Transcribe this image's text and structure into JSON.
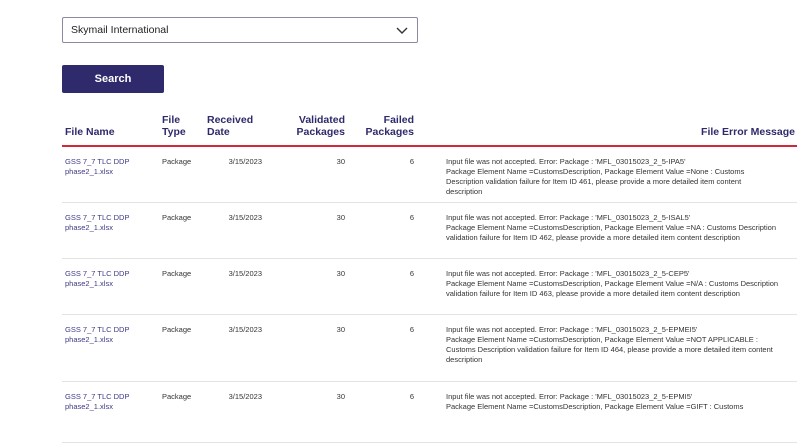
{
  "filter": {
    "selected": "Skymail International"
  },
  "search_button": "Search",
  "table": {
    "headers": {
      "file_name": "File Name",
      "file_type": [
        "File",
        "Type"
      ],
      "received_date": [
        "Received",
        "Date"
      ],
      "validated": [
        "Validated",
        "Packages"
      ],
      "failed": [
        "Failed",
        "Packages"
      ],
      "error": "File Error Message"
    },
    "rows": [
      {
        "file_name": [
          "GSS 7_7 TLC DDP",
          "phase2_1.xlsx"
        ],
        "file_type": "Package",
        "received_date": "3/15/2023",
        "validated": "30",
        "failed": "6",
        "error": [
          "Input file was not accepted. Error: Package : 'MFL_03015023_2_5-IPA5'",
          "Package Element Name =CustomsDescription, Package Element Value =None : Customs",
          "Description validation failure for Item ID 461, please provide a more detailed item content",
          "description"
        ]
      },
      {
        "file_name": [
          "GSS 7_7 TLC DDP",
          "phase2_1.xlsx"
        ],
        "file_type": "Package",
        "received_date": "3/15/2023",
        "validated": "30",
        "failed": "6",
        "error": [
          "Input file was not accepted. Error: Package : 'MFL_03015023_2_5-ISAL5'",
          "Package Element Name =CustomsDescription, Package Element Value =NA : Customs Description",
          "validation failure for Item ID 462, please provide a more detailed item content description"
        ]
      },
      {
        "file_name": [
          "GSS 7_7 TLC DDP",
          "phase2_1.xlsx"
        ],
        "file_type": "Package",
        "received_date": "3/15/2023",
        "validated": "30",
        "failed": "6",
        "error": [
          "Input file was not accepted. Error: Package : 'MFL_03015023_2_5-CEP5'",
          "Package Element Name =CustomsDescription, Package Element Value =N/A : Customs Description",
          "validation failure for Item ID 463, please provide a more detailed item content description"
        ]
      },
      {
        "file_name": [
          "GSS 7_7 TLC DDP",
          "phase2_1.xlsx"
        ],
        "file_type": "Package",
        "received_date": "3/15/2023",
        "validated": "30",
        "failed": "6",
        "error": [
          "Input file was not accepted. Error: Package : 'MFL_03015023_2_5-EPMEI5'",
          "Package Element Name =CustomsDescription, Package Element Value =NOT APPLICABLE :",
          "Customs Description validation failure for Item ID 464, please provide a more detailed item content",
          "description"
        ]
      },
      {
        "file_name": [
          "GSS 7_7 TLC DDP",
          "phase2_1.xlsx"
        ],
        "file_type": "Package",
        "received_date": "3/15/2023",
        "validated": "30",
        "failed": "6",
        "error": [
          "Input file was not accepted. Error: Package : 'MFL_03015023_2_5-EPMI5'",
          "Package Element Name =CustomsDescription, Package Element Value =GIFT : Customs"
        ]
      }
    ]
  }
}
